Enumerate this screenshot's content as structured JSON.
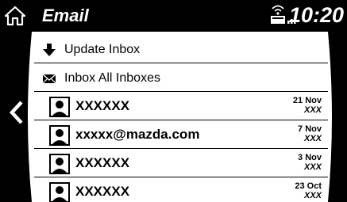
{
  "header": {
    "title": "Email",
    "clock": "10:20",
    "home_icon": "home-icon",
    "status_icon": "phone-signal-icon"
  },
  "nav": {
    "back_icon": "chevron-left-icon"
  },
  "actions": [
    {
      "label": "Update Inbox",
      "icon": "download-arrow-icon"
    },
    {
      "label": "Inbox All Inboxes",
      "icon": "envelope-icon"
    }
  ],
  "messages": [
    {
      "sender": "XXXXXX",
      "date": "21 Nov",
      "time": "XXX"
    },
    {
      "sender": "xxxxx@mazda.com",
      "date": "7 Nov",
      "time": "XXX"
    },
    {
      "sender": "XXXXXX",
      "date": "3 Nov",
      "time": "XXX"
    },
    {
      "sender": "XXXXXX",
      "date": "23 Oct",
      "time": "XXX"
    }
  ]
}
